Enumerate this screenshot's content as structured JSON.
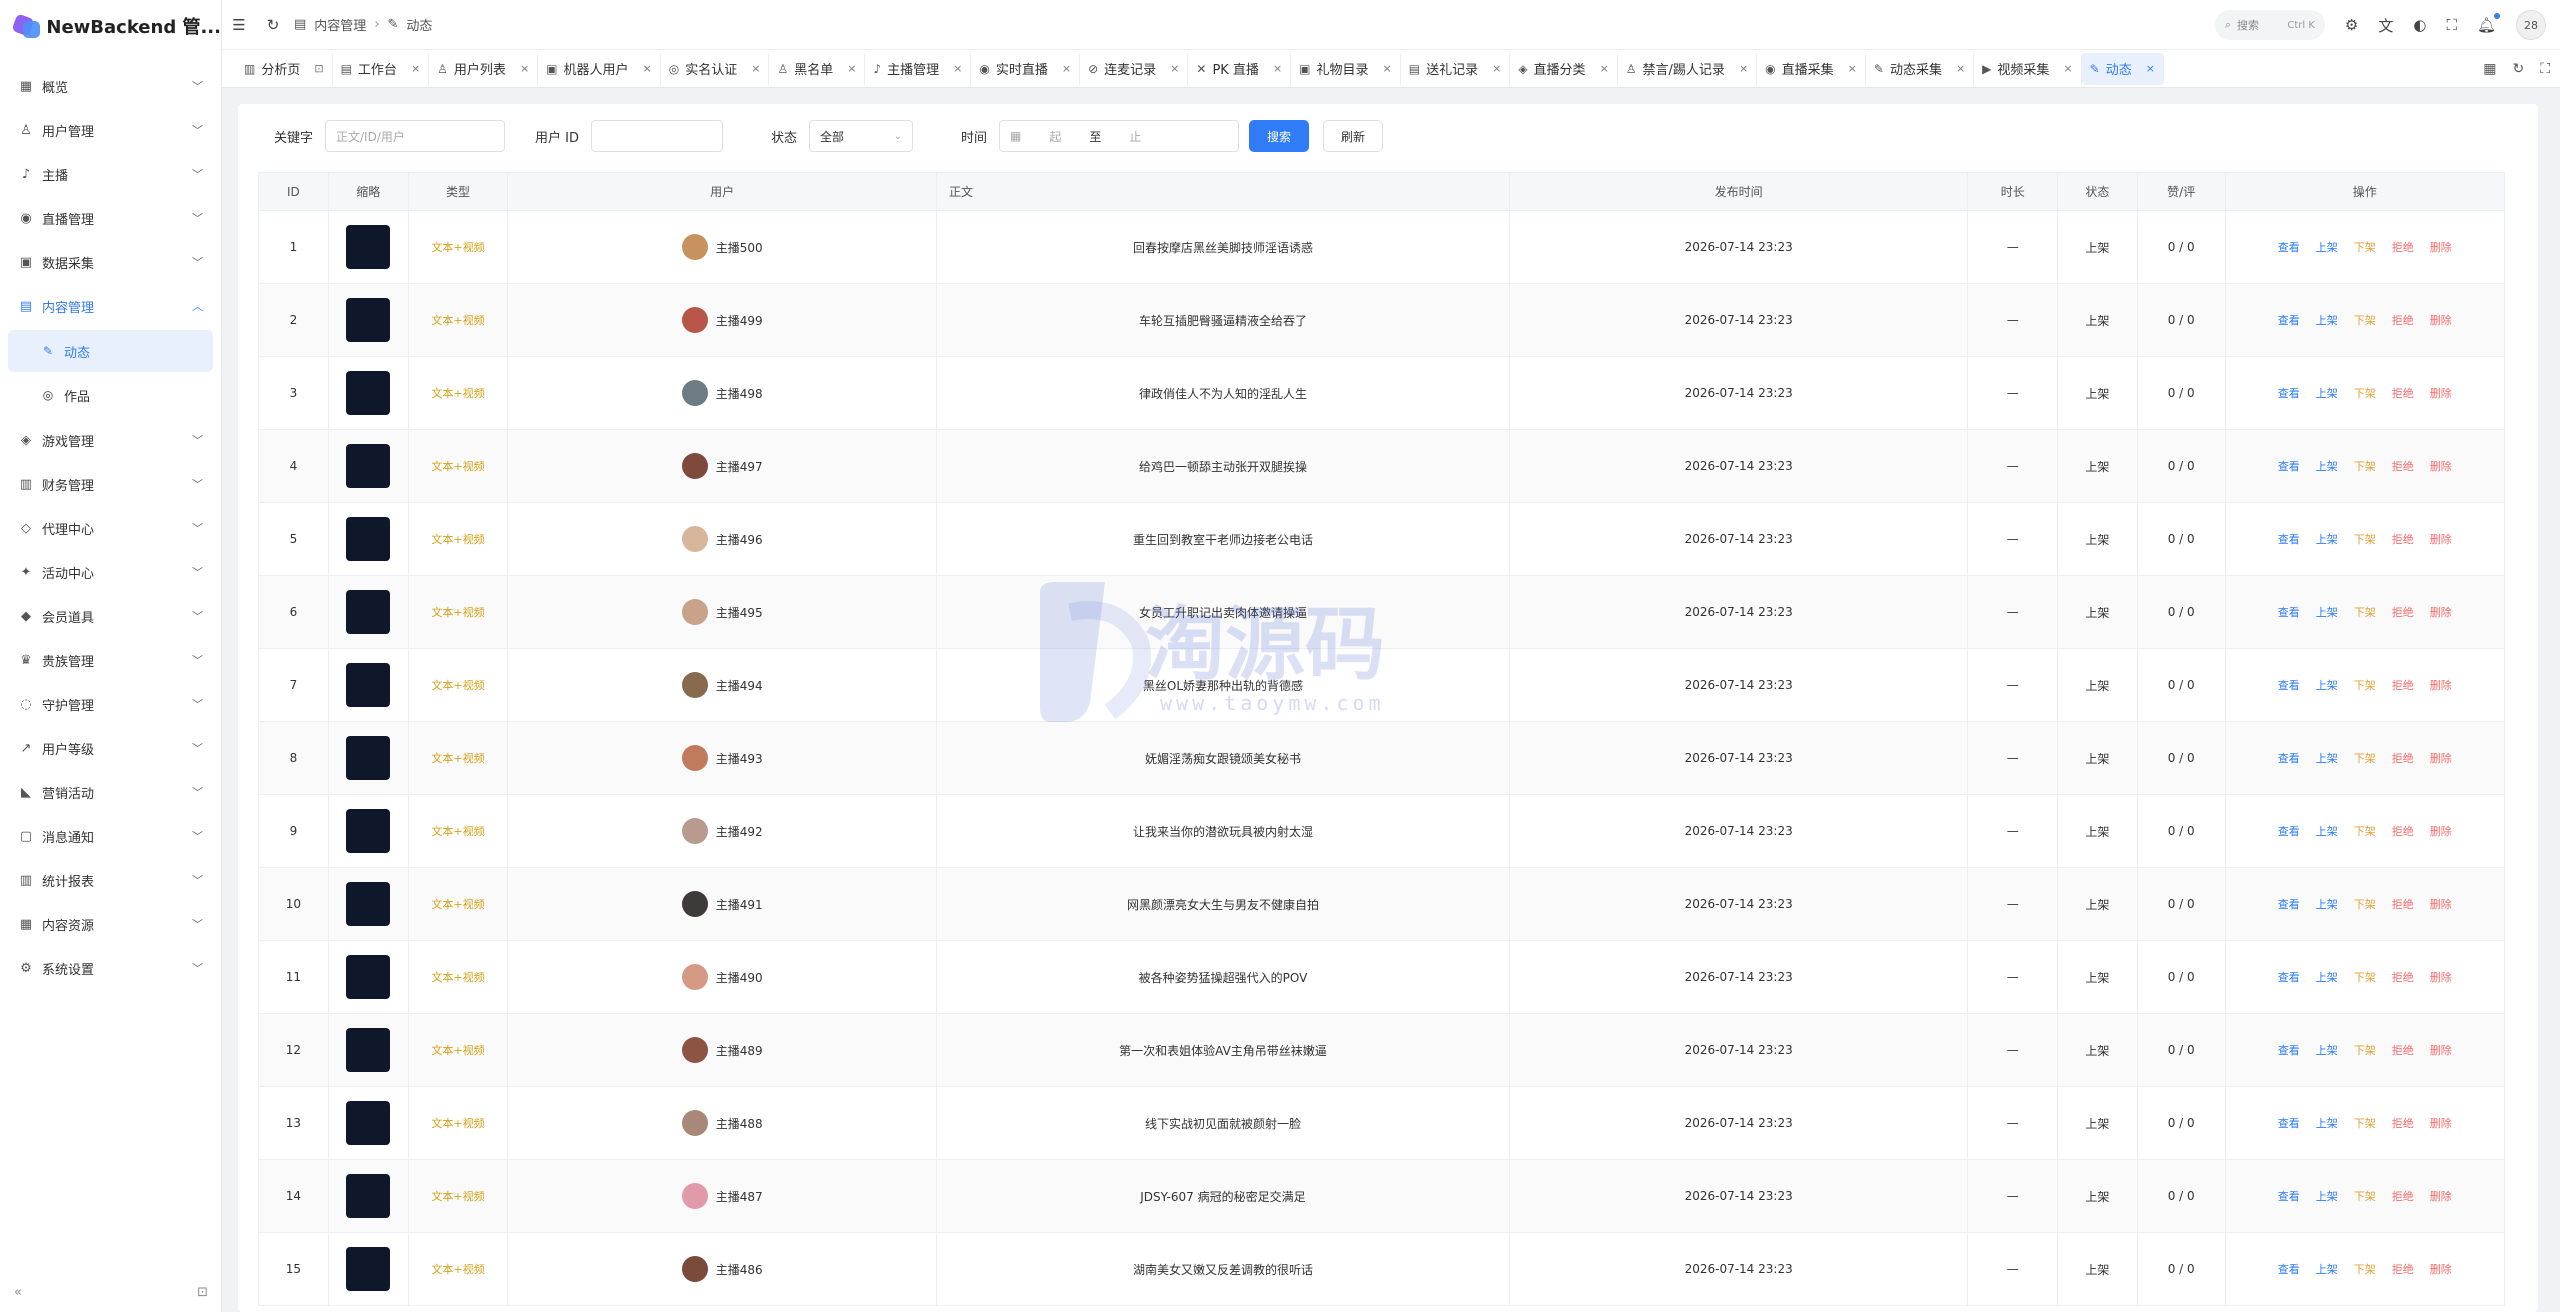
{
  "app": {
    "title": "NewBackend 管..."
  },
  "sidebar": {
    "items": [
      {
        "label": "概览",
        "icon": "grid-icon",
        "glyph": "▦"
      },
      {
        "label": "用户管理",
        "icon": "user-icon",
        "glyph": "♙"
      },
      {
        "label": "主播",
        "icon": "mic-icon",
        "glyph": "♪"
      },
      {
        "label": "直播管理",
        "icon": "broadcast-icon",
        "glyph": "◉"
      },
      {
        "label": "数据采集",
        "icon": "database-icon",
        "glyph": "▣"
      },
      {
        "label": "内容管理",
        "icon": "content-icon",
        "glyph": "▤"
      },
      {
        "label": "游戏管理",
        "icon": "gamepad-icon",
        "glyph": "◈"
      },
      {
        "label": "财务管理",
        "icon": "wallet-icon",
        "glyph": "▥"
      },
      {
        "label": "代理中心",
        "icon": "shield-icon",
        "glyph": "◇"
      },
      {
        "label": "活动中心",
        "icon": "puzzle-icon",
        "glyph": "✦"
      },
      {
        "label": "会员道具",
        "icon": "diamond-icon",
        "glyph": "◆"
      },
      {
        "label": "贵族管理",
        "icon": "crown-icon",
        "glyph": "♛"
      },
      {
        "label": "守护管理",
        "icon": "guard-icon",
        "glyph": "◌"
      },
      {
        "label": "用户等级",
        "icon": "trend-icon",
        "glyph": "↗"
      },
      {
        "label": "营销活动",
        "icon": "megaphone-icon",
        "glyph": "◣"
      },
      {
        "label": "消息通知",
        "icon": "message-icon",
        "glyph": "▢"
      },
      {
        "label": "统计报表",
        "icon": "chart-icon",
        "glyph": "▥"
      },
      {
        "label": "内容资源",
        "icon": "resource-icon",
        "glyph": "▦"
      },
      {
        "label": "系统设置",
        "icon": "gear-icon",
        "glyph": "⚙"
      }
    ],
    "submenu": [
      {
        "label": "动态",
        "icon": "edit-icon",
        "glyph": "✎"
      },
      {
        "label": "作品",
        "icon": "circle-icon",
        "glyph": "◎"
      }
    ],
    "collapse_glyph": "«",
    "pin_glyph": "⊡"
  },
  "topbar": {
    "breadcrumb_parent": "内容管理",
    "breadcrumb_current": "动态",
    "search_placeholder": "搜索",
    "search_shortcut": "Ctrl K",
    "avatar_text": "28"
  },
  "tabs": [
    {
      "label": "分析页",
      "icon": "▥",
      "close": "⊡"
    },
    {
      "label": "工作台",
      "icon": "▤",
      "close": "×"
    },
    {
      "label": "用户列表",
      "icon": "♙",
      "close": "×"
    },
    {
      "label": "机器人用户",
      "icon": "▣",
      "close": "×"
    },
    {
      "label": "实名认证",
      "icon": "◎",
      "close": "×"
    },
    {
      "label": "黑名单",
      "icon": "♙",
      "close": "×"
    },
    {
      "label": "主播管理",
      "icon": "♪",
      "close": "×"
    },
    {
      "label": "实时直播",
      "icon": "◉",
      "close": "×"
    },
    {
      "label": "连麦记录",
      "icon": "⊘",
      "close": "×"
    },
    {
      "label": "PK 直播",
      "icon": "✕",
      "close": "×"
    },
    {
      "label": "礼物目录",
      "icon": "▣",
      "close": "×"
    },
    {
      "label": "送礼记录",
      "icon": "▤",
      "close": "×"
    },
    {
      "label": "直播分类",
      "icon": "◈",
      "close": "×"
    },
    {
      "label": "禁言/踢人记录",
      "icon": "♙",
      "close": "×"
    },
    {
      "label": "直播采集",
      "icon": "◉",
      "close": "×"
    },
    {
      "label": "动态采集",
      "icon": "✎",
      "close": "×"
    },
    {
      "label": "视频采集",
      "icon": "▶",
      "close": "×"
    },
    {
      "label": "动态",
      "icon": "✎",
      "close": "×"
    }
  ],
  "filters": {
    "keyword_label": "关键字",
    "keyword_placeholder": "正文/ID/用户",
    "userid_label": "用户 ID",
    "status_label": "状态",
    "status_value": "全部",
    "time_label": "时间",
    "time_start": "起",
    "time_sep": "至",
    "time_end": "止",
    "search_button": "搜索",
    "refresh_button": "刷新"
  },
  "table": {
    "headers": [
      "ID",
      "缩略",
      "类型",
      "用户",
      "正文",
      "发布时间",
      "时长",
      "状态",
      "赞/评",
      "操作"
    ],
    "ops": [
      "查看",
      "上架",
      "下架",
      "拒绝",
      "删除"
    ],
    "rows": [
      {
        "id": "1",
        "type": "文本+视频",
        "user": "主播500",
        "text": "回春按摩店黑丝美脚技师淫语诱惑",
        "time": "2026-07-14 23:23",
        "duration": "—",
        "status": "上架",
        "likes": "0 / 0",
        "av": "#c8925f"
      },
      {
        "id": "2",
        "type": "文本+视频",
        "user": "主播499",
        "text": "车轮互插肥臀骚逼精液全给吞了",
        "time": "2026-07-14 23:23",
        "duration": "—",
        "status": "上架",
        "likes": "0 / 0",
        "av": "#b9564a"
      },
      {
        "id": "3",
        "type": "文本+视频",
        "user": "主播498",
        "text": "律政俏佳人不为人知的淫乱人生",
        "time": "2026-07-14 23:23",
        "duration": "—",
        "status": "上架",
        "likes": "0 / 0",
        "av": "#6e7b84"
      },
      {
        "id": "4",
        "type": "文本+视频",
        "user": "主播497",
        "text": "给鸡巴一顿舔主动张开双腿挨操",
        "time": "2026-07-14 23:23",
        "duration": "—",
        "status": "上架",
        "likes": "0 / 0",
        "av": "#7d4a3c"
      },
      {
        "id": "5",
        "type": "文本+视频",
        "user": "主播496",
        "text": "重生回到教室干老师边接老公电话",
        "time": "2026-07-14 23:23",
        "duration": "—",
        "status": "上架",
        "likes": "0 / 0",
        "av": "#d8b69a"
      },
      {
        "id": "6",
        "type": "文本+视频",
        "user": "主播495",
        "text": "女员工升职记出卖肉体邀请操逼",
        "time": "2026-07-14 23:23",
        "duration": "—",
        "status": "上架",
        "likes": "0 / 0",
        "av": "#c9a28a"
      },
      {
        "id": "7",
        "type": "文本+视频",
        "user": "主播494",
        "text": "黑丝OL娇妻那种出轨的背德感",
        "time": "2026-07-14 23:23",
        "duration": "—",
        "status": "上架",
        "likes": "0 / 0",
        "av": "#8a6a4e"
      },
      {
        "id": "8",
        "type": "文本+视频",
        "user": "主播493",
        "text": "妩媚淫荡痴女跟镜颂美女秘书",
        "time": "2026-07-14 23:23",
        "duration": "—",
        "status": "上架",
        "likes": "0 / 0",
        "av": "#c07a5c"
      },
      {
        "id": "9",
        "type": "文本+视频",
        "user": "主播492",
        "text": "让我来当你的潜欲玩具被内射太湿",
        "time": "2026-07-14 23:23",
        "duration": "—",
        "status": "上架",
        "likes": "0 / 0",
        "av": "#b89a8f"
      },
      {
        "id": "10",
        "type": "文本+视频",
        "user": "主播491",
        "text": "网黑颜漂亮女大生与男友不健康自拍",
        "time": "2026-07-14 23:23",
        "duration": "—",
        "status": "上架",
        "likes": "0 / 0",
        "av": "#3e3a39"
      },
      {
        "id": "11",
        "type": "文本+视频",
        "user": "主播490",
        "text": "被各种姿势猛操超强代入的POV",
        "time": "2026-07-14 23:23",
        "duration": "—",
        "status": "上架",
        "likes": "0 / 0",
        "av": "#d49a86"
      },
      {
        "id": "12",
        "type": "文本+视频",
        "user": "主播489",
        "text": "第一次和表姐体验AV主角吊带丝袜嫩逼",
        "time": "2026-07-14 23:23",
        "duration": "—",
        "status": "上架",
        "likes": "0 / 0",
        "av": "#8d5444"
      },
      {
        "id": "13",
        "type": "文本+视频",
        "user": "主播488",
        "text": "线下实战初见面就被颜射一脸",
        "time": "2026-07-14 23:23",
        "duration": "—",
        "status": "上架",
        "likes": "0 / 0",
        "av": "#a88878"
      },
      {
        "id": "14",
        "type": "文本+视频",
        "user": "主播487",
        "text": "JDSY-607 病冠的秘密足交满足",
        "time": "2026-07-14 23:23",
        "duration": "—",
        "status": "上架",
        "likes": "0 / 0",
        "av": "#e09aa8"
      },
      {
        "id": "15",
        "type": "文本+视频",
        "user": "主播486",
        "text": "湖南美女又嫩又反差调教的很听话",
        "time": "2026-07-14 23:23",
        "duration": "—",
        "status": "上架",
        "likes": "0 / 0",
        "av": "#7a4a3a"
      }
    ]
  },
  "watermark": {
    "big": "淘源码",
    "small": "www.taoymw.com"
  },
  "colors": {
    "accent": "#2f7cf6",
    "warning": "#e6a23c",
    "danger": "#f56c6c",
    "tag": "#d4a217"
  }
}
